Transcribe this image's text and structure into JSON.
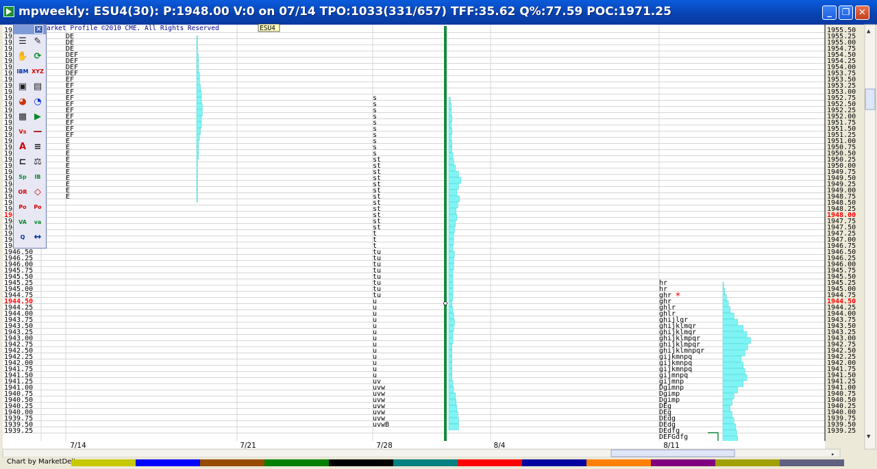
{
  "window": {
    "title": "mpweekly: ESU4(30): P:1948.00 V:0 on 07/14 TPO:1033(331/657) TFF:35.62 Q%:77.59 POC:1971.25",
    "minimize": "_",
    "maximize": "❐",
    "close": "✕"
  },
  "copyright": "arket Profile ©2010 CME. All Rights Reserved",
  "symbol_tag": "ESU4",
  "toolbar": {
    "close": "✕",
    "tools": [
      "bars-icon",
      "pencil-icon",
      "hand-icon",
      "refresh-icon",
      "ibm-icon",
      "xyz-icon",
      "camera-icon",
      "notes-icon",
      "pie-icon",
      "pie2-icon",
      "grid-icon",
      "play-icon",
      "vs-icon",
      "line-icon",
      "text-a-icon",
      "list-icon",
      "split-icon",
      "balance-icon",
      "sp-icon",
      "ib-icon",
      "or-icon",
      "diamond-icon",
      "poc-icon",
      "pocv-icon",
      "va-icon",
      "vavo-icon",
      "q-icon",
      "arrows-icon"
    ],
    "labels": {
      "ibm": "IBM",
      "xyz": "XYZ",
      "vs": "Vs",
      "sp": "Sp",
      "ib": "IB",
      "or": "OR",
      "poc": "Po c",
      "pocv": "Po cv",
      "va": "VA",
      "vavo": "va vo",
      "q": "Q"
    }
  },
  "status": {
    "text": "Chart by MarketDelta"
  },
  "colors": {
    "grid": "#d6d6d6",
    "histogram": "#80f4f4",
    "histogram_edge": "#40c8c8",
    "poc_line": "#138a3c",
    "price_highlight": "#ff0000",
    "star": "#ff0000",
    "swatches": [
      "#ffffff",
      "#c8c800",
      "#0000ff",
      "#964b00",
      "#008000",
      "#000000",
      "#008080",
      "#ff0000",
      "#0000a0",
      "#ff8000",
      "#800080",
      "#a0a000",
      "#606080"
    ]
  },
  "chart_data": {
    "type": "market-profile",
    "y_range": [
      1939.25,
      1955.5
    ],
    "tick_step": 0.25,
    "current_price": 1948.0,
    "highlight_price": 1944.5,
    "y_ticks": [
      "1955.50",
      "1955.25",
      "1955.00",
      "1954.75",
      "1954.50",
      "1954.25",
      "1954.00",
      "1953.75",
      "1953.50",
      "1953.25",
      "1953.00",
      "1952.75",
      "1952.50",
      "1952.25",
      "1952.00",
      "1951.75",
      "1951.50",
      "1951.25",
      "1951.00",
      "1950.75",
      "1950.50",
      "1950.25",
      "1950.00",
      "1949.75",
      "1949.50",
      "1949.25",
      "1949.00",
      "1948.75",
      "1948.50",
      "1948.25",
      "1948.00",
      "1947.75",
      "1947.50",
      "1947.25",
      "1947.00",
      "1946.75",
      "1946.50",
      "1946.25",
      "1946.00",
      "1945.75",
      "1945.50",
      "1945.25",
      "1945.00",
      "1944.75",
      "1944.50",
      "1944.25",
      "1944.00",
      "1943.75",
      "1943.50",
      "1943.25",
      "1943.00",
      "1942.75",
      "1942.50",
      "1942.25",
      "1942.00",
      "1941.75",
      "1941.50",
      "1941.25",
      "1941.00",
      "1940.75",
      "1940.50",
      "1940.25",
      "1940.00",
      "1939.75",
      "1939.50",
      "1939.25"
    ],
    "x_labels": [
      "7/14",
      "7/21",
      "7/28",
      "8/4",
      "8/11"
    ],
    "profiles": [
      {
        "label": "7/14",
        "top_price": 1955.25,
        "letters": [
          "DE",
          "DE",
          "DE",
          "DEF",
          "DEF",
          "DEF",
          "DEF",
          "EF",
          "EF",
          "EF",
          "EF",
          "EF",
          "EF",
          "EF",
          "EF",
          "EF",
          "EF",
          "E",
          "E",
          "E",
          "E",
          "E",
          "E",
          "E",
          "E",
          "E",
          "E"
        ],
        "volume": [
          1,
          1,
          1,
          2,
          2,
          2,
          3,
          3,
          4,
          5,
          5,
          6,
          6,
          5,
          5,
          4,
          3,
          2,
          2,
          2,
          1,
          1,
          1,
          1,
          1,
          1,
          1
        ]
      },
      {
        "label": "7/28",
        "top_price": 1952.75,
        "letters": [
          "s",
          "s",
          "s",
          "s",
          "s",
          "s",
          "s",
          "s",
          "s",
          "s",
          "st",
          "st",
          "st",
          "st",
          "st",
          "st",
          "st",
          "st",
          "st",
          "st",
          "st",
          "st",
          "t",
          "t",
          "t",
          "tu",
          "tu",
          "tu",
          "tu",
          "tu",
          "tu",
          "tu",
          "tu",
          "u",
          "u",
          "u",
          "u",
          "u",
          "u",
          "u",
          "u",
          "u",
          "u",
          "u",
          "u",
          "u",
          "uv",
          "uvw",
          "uvw",
          "uvw",
          "uvw",
          "uvw",
          "uvw",
          "uvwB"
        ],
        "volume": [
          2,
          3,
          3,
          4,
          3,
          4,
          3,
          4,
          4,
          5,
          6,
          8,
          12,
          15,
          12,
          10,
          13,
          11,
          9,
          10,
          8,
          7,
          6,
          6,
          5,
          7,
          6,
          6,
          5,
          5,
          5,
          5,
          5,
          4,
          5,
          6,
          7,
          6,
          5,
          5,
          4,
          4,
          4,
          4,
          4,
          4,
          5,
          6,
          8,
          9,
          10,
          11,
          12,
          12
        ]
      },
      {
        "label": "8/11",
        "top_price": 1945.25,
        "letters": [
          "hr",
          "hr",
          "ghr",
          "ghr",
          "ghlr",
          "ghlr",
          "ghijlqr",
          "ghijklmqr",
          "ghijklmqr",
          "ghijklmpqr",
          "ghijklmpqr",
          "ghijklmnpqr",
          "gijkmnpq",
          "gijkmnpq",
          "gijkmnpq",
          "gijmnpq",
          "gijmnp",
          "Dgimnp",
          "Dgimp",
          "Dgimp",
          "DEg",
          "DEg",
          "DEdg",
          "DEdg",
          "DEdfg",
          "DEFGdfg"
        ],
        "volume": [
          1,
          2,
          4,
          6,
          8,
          12,
          16,
          22,
          26,
          30,
          27,
          24,
          20,
          22,
          24,
          26,
          22,
          16,
          12,
          10,
          8,
          10,
          12,
          14,
          15,
          16
        ]
      }
    ]
  }
}
